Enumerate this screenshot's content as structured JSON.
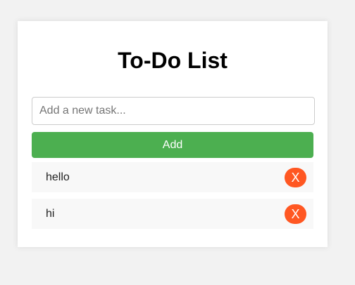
{
  "app": {
    "title": "To-Do List"
  },
  "input": {
    "placeholder": "Add a new task...",
    "value": ""
  },
  "add_button": {
    "label": "Add"
  },
  "tasks": [
    {
      "text": "hello",
      "delete_label": "X"
    },
    {
      "text": "hi",
      "delete_label": "X"
    }
  ],
  "colors": {
    "page_background": "#f2f2f2",
    "card_background": "#ffffff",
    "add_button": "#4caf50",
    "delete_button": "#ff5722",
    "task_background": "#f8f8f8"
  }
}
